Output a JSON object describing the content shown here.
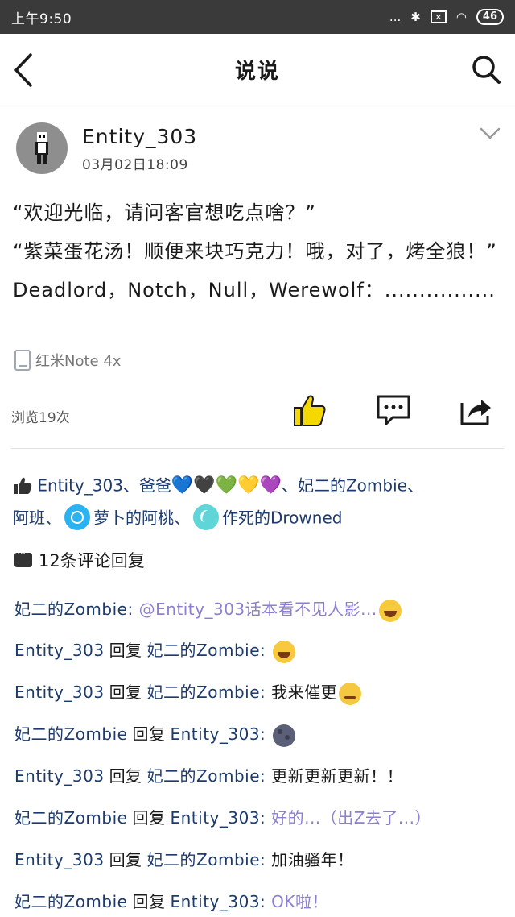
{
  "status_bar": {
    "time": "上午9:50",
    "dots": "...",
    "bluetooth": "✱",
    "sim": "✕",
    "wifi": "◠",
    "battery": "46"
  },
  "navbar": {
    "title": "说说"
  },
  "post": {
    "author": "Entity_303",
    "time": "03月02日18:09",
    "lines": [
      "“欢迎光临，请问客官想吃点啥？”",
      "“紫菜蛋花汤！顺便来块巧克力！哦，对了，烤全狼！”",
      "Deadlord，Notch，Null，Werewolf：................"
    ],
    "device": "红米Note 4x",
    "views": "浏览19次"
  },
  "likes": {
    "users": [
      "Entity_303",
      "爸爸",
      "妃二的Zombie",
      "阿班",
      "萝卜的阿桃",
      "作死的Drowned"
    ],
    "separator": "、",
    "hearts": [
      "💙",
      "🖤",
      "💚",
      "💛",
      "💜"
    ],
    "heart_colors": [
      "#2aa7e8",
      "#1c2a4a",
      "#8cc63f",
      "#f7b500",
      "#8a44d4"
    ]
  },
  "comments": {
    "count_label": "12条评论回复",
    "reply_word": "回复",
    "items": [
      {
        "from": "妃二的Zombie",
        "to": "",
        "text": "@Entity_303话本看不见人影...",
        "purple": true,
        "emoji": "laugh"
      },
      {
        "from": "Entity_303",
        "to": "妃二的Zombie",
        "text": "",
        "purple": false,
        "emoji": "laugh"
      },
      {
        "from": "Entity_303",
        "to": "妃二的Zombie",
        "text": "我来催更",
        "purple": false,
        "emoji": "smirk"
      },
      {
        "from": "妃二的Zombie",
        "to": "Entity_303",
        "text": "",
        "purple": false,
        "emoji": "moon"
      },
      {
        "from": "Entity_303",
        "to": "妃二的Zombie",
        "text": "更新更新更新！！",
        "purple": false,
        "emoji": ""
      },
      {
        "from": "妃二的Zombie",
        "to": "Entity_303",
        "text": "好的...（出Z去了...）",
        "purple": true,
        "emoji": ""
      },
      {
        "from": "Entity_303",
        "to": "妃二的Zombie",
        "text": "加油骚年！",
        "purple": false,
        "emoji": ""
      },
      {
        "from": "妃二的Zombie",
        "to": "Entity_303",
        "text": "OK啦！",
        "purple": true,
        "emoji": ""
      }
    ]
  }
}
